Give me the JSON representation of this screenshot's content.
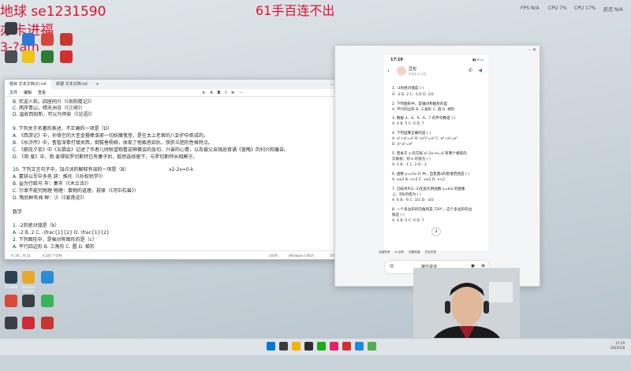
{
  "stream_overlay": {
    "line1": "地球 se1231590",
    "line2": "办卡进福",
    "line3": "3-?am",
    "top_center": "61手百连不出",
    "text_color": "#e0102c"
  },
  "perf_stats": [
    {
      "label": "FPS",
      "value": "N/A"
    },
    {
      "label": "CPU",
      "value": "7%"
    },
    {
      "label": "CPU",
      "value": "17%"
    },
    {
      "label": "延迟",
      "value": "N/A"
    }
  ],
  "desktop_icons": [
    {
      "label": "TFGAME",
      "color": "#2f3f4f"
    },
    {
      "label": "Rockstar Games",
      "color": "#e8a92a"
    },
    {
      "label": "",
      "color": "#2a8bd6"
    },
    {
      "label": "",
      "color": "#d84b3a"
    },
    {
      "label": "",
      "color": "#3cb35a"
    },
    {
      "label": "",
      "color": "#3a3f45"
    },
    {
      "label": "",
      "color": "#c7372f"
    },
    {
      "label": "",
      "color": "#d12a34"
    },
    {
      "label": "",
      "color": "#2a6fd1"
    }
  ],
  "notepad": {
    "tabs": [
      "题目 文本文档(2).txt",
      "新建 文本文档.txt"
    ],
    "menu": [
      "文件",
      "编辑",
      "查看"
    ],
    "format_icons": [
      "≡",
      "A",
      "B",
      "I",
      "≣",
      "⋯"
    ],
    "lines": [
      "B. 欢迎人和，四座同兴（《岳阳楼记》）",
      "C. 两岸青山，晴天洲日（《三峡》）",
      "D. 温故而知新，可以为师矣（《论语》）",
      "",
      "9. 下列关于名著的表述，不正确的一项是（D）",
      "A. 《西游记》中，孙悟空的大圣金箍棒诛邪一切妖魔鬼怪，是在太上老君的八卦炉中炼成的。",
      "B. 《水浒传》中，鲁智深拳打镇关西，倒拔垂杨柳，体现了他嫉恶如仇、侠肝义胆的性格特点。",
      "C. 《朝花夕拾》中《五猖会》记述了作者儿时盼望观看迎神赛会的急切、兴奋的心情，以及被父亲强迫背诵《鉴略》的扫兴和痛苦。",
      "D. 《简·爱》中，简·爱得知罗切斯特已有妻子后，毅然选择留下，与罗切斯特长相厮守。",
      "",
      "10. 下列文言句子中，加点词的解释有误的一项是（B）",
      "A. 蒙辞以军中多务  辞：推托（《孙权劝学》）",
      "B. 益为行殴马  市：集市（《木兰诗》）",
      "C. 尔聿不能究物理  物理：事物的道理、规律（《河中石兽》）",
      "D. 陶后鲜有闻  鲜：少（《爱莲说》）",
      "",
      "数学",
      "",
      "1. -2的绝对值是（b）",
      "A. -2  B. 2  C. -\\frac{1}{2}  D. \\frac{1}{2}",
      "2. 下列图形中，是轴对称图形的是（c）",
      "A. 平行四边形  B. 三角形  C. 圆  D. 梯形"
    ],
    "inline_note": "x2-2x=0-k",
    "status": {
      "position": "行 26，列 51",
      "chars": "4,587 个字符",
      "zoom": "100%",
      "line_ending": "Windows (CRLF)",
      "encoding": "UTF-8"
    }
  },
  "phone": {
    "time": "17:10",
    "contact_name": "豆包",
    "contact_sub": "内容由 AI 生成",
    "questions": [
      "1. -2的绝对值是 ( )",
      "A. -2  B. 2  C. -1/2  D. 1/2",
      "2. 下列图形中，是轴对称图形的是",
      "A. 平行四边形  B. 三角形  C. 圆  D. 梯形",
      "3. 数据 3、4、5、6、7 的平均数是 ( )",
      "A. 4  B. 5  C. 6  D. 7",
      "4. 下列运算正确的是 ( )",
      "A. a²+a³=a⁵  B. (a²)³=a⁶  C. a⁶÷a²=a³",
      "D. a²·a³=a⁶",
      "5. 若关于 x 的方程 x²-2x+k=0 有两个相等的",
      "实数根，则 k 的值为 ( )",
      "A. 1  B. -1  C. 2  D. -2",
      "6. 函数 y=√(x-2) 中，自变量x的取值范围是 ( )",
      "A. x≥2  B. x>2  C. x≤2  D. x<2",
      "7. 已知点P(2,-3)在反比例函数 y=k/x 的图象",
      "上，则k的值为 ( )",
      "A. 6  B. -6  C. 3/2  D. -3/2",
      "8. 一个多边形的内角和是 720°，这个多边形的边",
      "数是 ( )",
      "A. 4  B. 5  C. 6  D. 7"
    ],
    "toolbar": [
      "深度思考",
      "AI 创作",
      "拍题答疑",
      "豆包学堂"
    ],
    "chat_placeholder": "接住说话"
  },
  "taskbar": {
    "time": "17:10",
    "date": "2025/1/8",
    "icon_colors": [
      "#1a73e8",
      "#2e2e2e",
      "#f4b400",
      "#3b3b3b",
      "#1aad19",
      "#e91e63",
      "#d32f2f",
      "#0078d4",
      "#ffb900",
      "#00a4ef",
      "#1e88e5",
      "#4caf50"
    ]
  }
}
